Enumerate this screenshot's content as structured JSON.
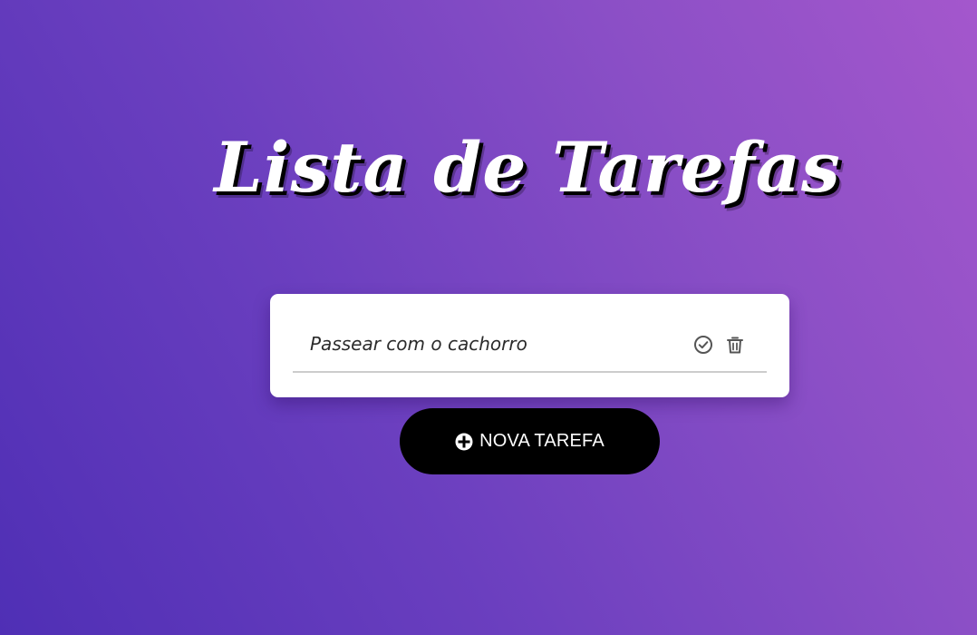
{
  "header": {
    "title": "Lista de Tarefas"
  },
  "tasks": [
    {
      "text": "Passear com o cachorro",
      "icons": [
        "check-circle-icon",
        "trash-icon"
      ]
    }
  ],
  "actions": {
    "add_task_label": "NOVA TAREFA",
    "add_task_icon": "plus-circle-icon"
  },
  "colors": {
    "background_start": "#4f2fb5",
    "background_end": "#a457cc",
    "card": "#ffffff",
    "button": "#000000",
    "icon": "#555555"
  }
}
